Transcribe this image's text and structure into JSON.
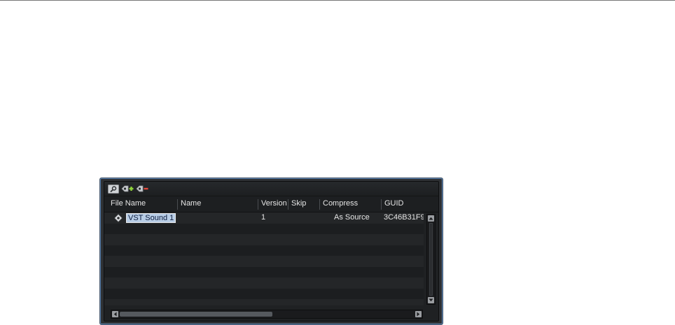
{
  "toolbar": {
    "buttons": [
      {
        "icon": "search-icon"
      },
      {
        "icon": "add-volume-icon"
      },
      {
        "icon": "remove-volume-icon"
      }
    ]
  },
  "table": {
    "columns": [
      "File Name",
      "Name",
      "Version",
      "Skip",
      "Compress",
      "GUID"
    ],
    "rows": [
      {
        "icon": "vst-sound-icon",
        "file_name": "VST Sound 1",
        "name": "",
        "version": "1",
        "skip": "",
        "compress": "As Source",
        "guid": "3C46B31F9"
      }
    ]
  },
  "colors": {
    "panel_bg": "#1f2123",
    "frame_accent": "#5f86b3",
    "selection_bg": "#b8cde6",
    "add_icon": "#8fd43a",
    "remove_icon": "#e5483b"
  }
}
